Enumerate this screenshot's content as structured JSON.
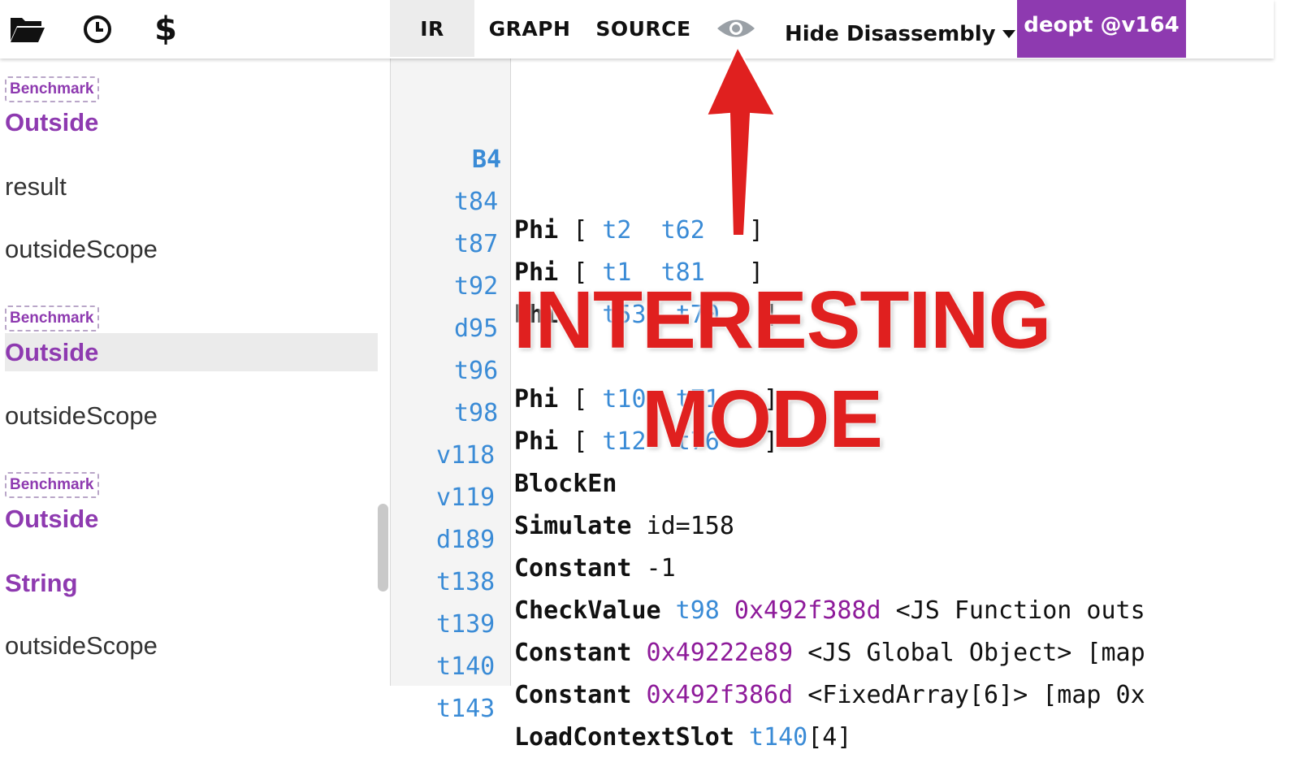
{
  "toolbar": {
    "icons": [
      "folder-open-icon",
      "clock-icon",
      "dollar-icon"
    ],
    "dollar_glyph": "$",
    "tabs": [
      {
        "label": "IR",
        "active": true
      },
      {
        "label": "GRAPH",
        "active": false
      },
      {
        "label": "SOURCE",
        "active": false
      }
    ],
    "eye_icon": "eye-icon",
    "disassembly_label": "Hide Disassembly",
    "deopt_label": "deopt @v164"
  },
  "sidebar": {
    "entries": [
      {
        "type": "badge",
        "text": "Benchmark"
      },
      {
        "type": "function",
        "text": "Outside"
      },
      {
        "type": "plain",
        "text": "result"
      },
      {
        "type": "plain",
        "text": "outsideScope"
      },
      {
        "type": "badge",
        "text": "Benchmark"
      },
      {
        "type": "function",
        "text": "Outside",
        "selected": true
      },
      {
        "type": "plain",
        "text": "outsideScope"
      },
      {
        "type": "badge",
        "text": "Benchmark"
      },
      {
        "type": "function",
        "text": "Outside"
      },
      {
        "type": "function",
        "text": "String"
      },
      {
        "type": "plain",
        "text": "outsideScope"
      }
    ]
  },
  "ir": {
    "block": "B4",
    "rows": [
      {
        "label": "t84",
        "op": "Phi",
        "args": "[ ",
        "a1": "t2",
        "a2": "t62",
        "end": " ]"
      },
      {
        "label": "t87",
        "op": "Phi",
        "args": "[ ",
        "a1": "t1",
        "a2": "t81",
        "end": " ]"
      },
      {
        "label": "t92",
        "op": "Phi",
        "args": "[ ",
        "a1": "t53",
        "a2": "t70",
        "end": " ]"
      },
      {
        "label": "d95",
        "op": "",
        "args": "",
        "a1": "",
        "a2": "",
        "end": ""
      },
      {
        "label": "t96",
        "op": "Phi",
        "args": "[ ",
        "a1": "t10",
        "a2": "t71",
        "end": " ]"
      },
      {
        "label": "t98",
        "op": "Phi",
        "args": "[ ",
        "a1": "t12",
        "a2": "t76",
        "end": " ]"
      },
      {
        "label": "v118",
        "op": "BlockEn",
        "args": "",
        "a1": "",
        "a2": "",
        "end": ""
      },
      {
        "label": "v119",
        "op": "Simulate",
        "rest": " id=158"
      },
      {
        "label": "d189",
        "op": "Constant",
        "rest": " -1"
      },
      {
        "label": "t138",
        "op": "CheckValue",
        "ref": " t98",
        "addr": " 0x492f388d",
        "rest": " <JS Function outs"
      },
      {
        "label": "t139",
        "op": "Constant",
        "addr": " 0x49222e89",
        "rest": " <JS Global Object> [map"
      },
      {
        "label": "t140",
        "op": "Constant",
        "addr": " 0x492f386d",
        "rest": " <FixedArray[6]> [map 0x"
      },
      {
        "label": "t143",
        "op": "LoadContextSlot",
        "ref": " t140",
        "rest": "[4]"
      }
    ]
  },
  "annotation": {
    "line1": "INTERESTING",
    "line2": "MODE",
    "color": "#e0201f"
  }
}
